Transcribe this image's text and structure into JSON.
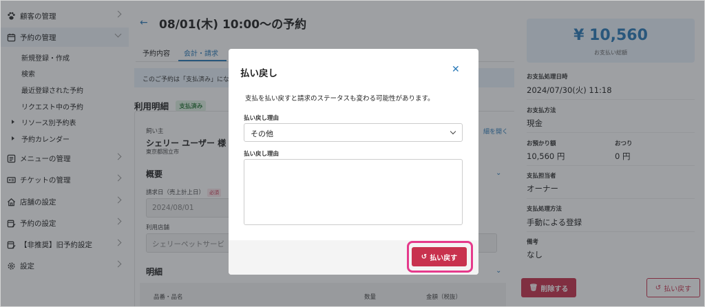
{
  "sidebar": {
    "items": [
      {
        "label": "顧客の管理"
      },
      {
        "label": "予約の管理"
      },
      {
        "label": "メニューの管理"
      },
      {
        "label": "チケットの管理"
      },
      {
        "label": "店舗の設定"
      },
      {
        "label": "予約の設定"
      },
      {
        "label": "【非推奨】旧予約設定"
      },
      {
        "label": "設定"
      }
    ],
    "sub_items": [
      "新規登録・作成",
      "検索",
      "最近登録された予約",
      "リクエスト中の予約",
      "リソース別予約表",
      "予約カレンダー"
    ]
  },
  "main": {
    "title": "08/01(木) 10:00〜の予約",
    "tabs": [
      "予約内容",
      "会計・請求"
    ],
    "notice": "このご予約は「支払済み」になっ",
    "section_title": "利用明細",
    "status_badge": "支払済み",
    "buyer_label": "飼い主",
    "buyer_name": "シェリー ユーザー 様",
    "buyer_address": "東京都国立市",
    "open_link": "細を開く",
    "overview_title": "概要",
    "bill_date_label": "請求日（売上計上日）",
    "required": "必須",
    "bill_date_value": "2024/08/01",
    "store_label": "利用店舗",
    "store_value": "シェリーペットサービ",
    "detail_title": "明細",
    "table_headers": [
      "品番・品名",
      "数量",
      "金額（税抜）"
    ]
  },
  "right_panel": {
    "amount": "¥ 10,560",
    "amount_label": "お支払い総額",
    "fields": [
      {
        "label": "お支払処理日時",
        "value": "2024/07/30(火) 11:18"
      },
      {
        "label": "お支払方法",
        "value": "現金"
      },
      {
        "label": "お預かり額",
        "value": "10,560 円"
      },
      {
        "label": "おつり",
        "value": "0 円"
      },
      {
        "label": "支払担当者",
        "value": "オーナー"
      },
      {
        "label": "支払処理方法",
        "value": "手動による登録"
      },
      {
        "label": "備考",
        "value": "なし"
      }
    ],
    "delete_button": "削除する",
    "refund_button": "払い戻す"
  },
  "modal": {
    "title": "払い戻し",
    "description": "支払を払い戻すと請求のステータスも変わる可能性があります。",
    "reason_select_label": "払い戻し理由",
    "reason_select_value": "その他",
    "reason_text_label": "払い戻し理由",
    "submit_button": "払い戻す"
  },
  "colors": {
    "accent_blue": "#2a7ab8",
    "danger_red": "#c8324e",
    "highlight_pink": "#e5398b",
    "success_green": "#2d7a3c"
  }
}
